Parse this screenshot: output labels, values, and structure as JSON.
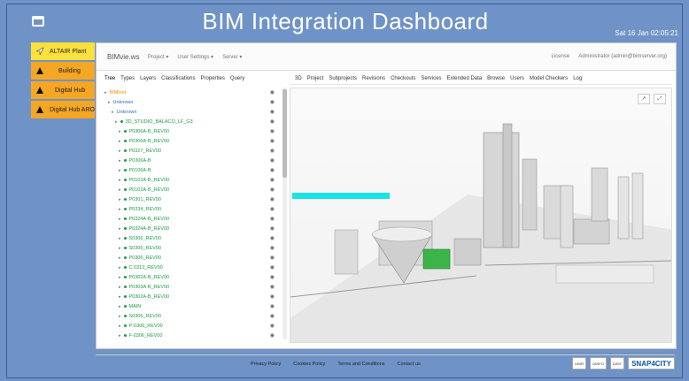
{
  "header": {
    "title": "BIM Integration Dashboard",
    "clock": "Sat 16 Jan 02:05:21"
  },
  "sidebar": {
    "items": [
      {
        "label": "ALTAIR Plant",
        "icon": "location-arrow-icon"
      },
      {
        "label": "Building",
        "icon": "warning-triangle-icon"
      },
      {
        "label": "Digital Hub",
        "icon": "warning-triangle-icon"
      },
      {
        "label": "Digital Hub ARO",
        "icon": "warning-triangle-icon"
      }
    ]
  },
  "topbar": {
    "brand": "BIMvie.ws",
    "menus": [
      "Project ▾",
      "User Settings ▾",
      "Server ▾"
    ],
    "license": "License",
    "user": "Administrator (admin@bimserver.org)"
  },
  "left_tabs": [
    "Tree",
    "Types",
    "Layers",
    "Classifications",
    "Properties",
    "Query"
  ],
  "tree": [
    {
      "label": "BIMtest",
      "kind": "root"
    },
    {
      "label": "Unknown",
      "kind": "blue"
    },
    {
      "label": "Unknown",
      "kind": "blue"
    },
    {
      "label": "3D_STUDIO_BALACO_LF_G3",
      "kind": "green"
    },
    {
      "label": "P0306A-B_REV00",
      "kind": "green"
    },
    {
      "label": "P0306A-B_REV00",
      "kind": "green"
    },
    {
      "label": "P0327_REV00",
      "kind": "green"
    },
    {
      "label": "P0306A-B",
      "kind": "green"
    },
    {
      "label": "P0106A-B",
      "kind": "green"
    },
    {
      "label": "P0102A-B_REV00",
      "kind": "green"
    },
    {
      "label": "P0102A-B_REV00",
      "kind": "green"
    },
    {
      "label": "P0301_REV00",
      "kind": "green"
    },
    {
      "label": "P0334_REV00",
      "kind": "green"
    },
    {
      "label": "P0324A-B_REV00",
      "kind": "green"
    },
    {
      "label": "P0324A-B_REV00",
      "kind": "green"
    },
    {
      "label": "S0306_REV00",
      "kind": "green"
    },
    {
      "label": "S0306_REV00",
      "kind": "green"
    },
    {
      "label": "P0306_REV00",
      "kind": "green"
    },
    {
      "label": "C.0313_REV00",
      "kind": "green"
    },
    {
      "label": "P0302A-B_REV00",
      "kind": "green"
    },
    {
      "label": "P0303A-B_REV00",
      "kind": "green"
    },
    {
      "label": "P0302A-B_REV00",
      "kind": "green"
    },
    {
      "label": "MAIN",
      "kind": "green"
    },
    {
      "label": "S0306_REV00",
      "kind": "green"
    },
    {
      "label": "P-0306_REV00",
      "kind": "green"
    },
    {
      "label": "F-0306_REV00",
      "kind": "green"
    }
  ],
  "right_tabs": [
    "3D",
    "Project",
    "Subprojects",
    "Revisions",
    "Checkouts",
    "Services",
    "Extended Data",
    "Browse",
    "Users",
    "Model Checkers",
    "Log"
  ],
  "footer": {
    "links": [
      "Privacy Policy",
      "Cookies Policy",
      "Terms and Conditions",
      "Contact us"
    ],
    "logos": [
      "UNIFI",
      "DINFO",
      "DISIT",
      "SNAP4CITY"
    ]
  },
  "colors": {
    "page_bg": "#6f93c6",
    "sidebar_item": "#f5a623",
    "sidebar_active": "#fce03b",
    "tree_green": "#1c9d45"
  }
}
